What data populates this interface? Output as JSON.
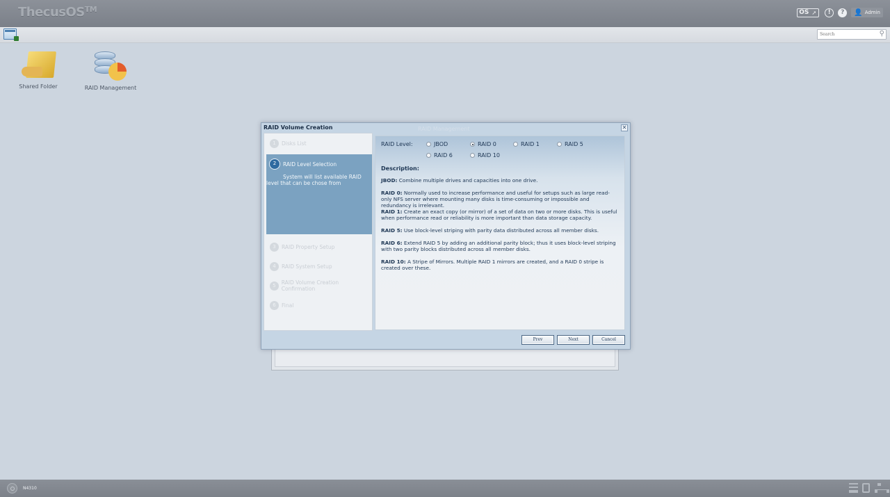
{
  "app": {
    "brand": "ThecusOS",
    "brand_tm": "TM",
    "os_badge": "OS",
    "admin_label": "Admin"
  },
  "search": {
    "placeholder": "Search"
  },
  "desktop": {
    "icons": [
      {
        "label": "Shared Folder",
        "icon": "shared-folder-icon"
      },
      {
        "label": "RAID Management",
        "icon": "raid-management-icon"
      }
    ]
  },
  "dialog": {
    "title": "RAID Volume Creation",
    "ghost_title": "RAID Management",
    "steps": [
      {
        "num": "1",
        "label": "Disks List"
      },
      {
        "num": "2",
        "label": "RAID Level Selection",
        "desc": "System will list available RAID level that can be chose from"
      },
      {
        "num": "3",
        "label": "RAID Property Setup"
      },
      {
        "num": "4",
        "label": "RAID System Setup"
      },
      {
        "num": "5",
        "label": "RAID Volume Creation Confirmation"
      },
      {
        "num": "6",
        "label": "Final"
      }
    ],
    "raid_level_label": "RAID Level:",
    "options": [
      {
        "label": "JBOD",
        "selected": false
      },
      {
        "label": "RAID 0",
        "selected": true
      },
      {
        "label": "RAID 1",
        "selected": false
      },
      {
        "label": "RAID 5",
        "selected": false
      },
      {
        "label": "RAID 6",
        "selected": false
      },
      {
        "label": "RAID 10",
        "selected": false
      }
    ],
    "description_title": "Description:",
    "descriptions": [
      {
        "term": "JBOD:",
        "text": " Combine multiple drives and capacities into one drive."
      },
      {
        "term": "RAID 0:",
        "text": " Normally used to increase performance and useful for setups such as large read-only NFS server where mounting many disks is time-consuming or impossible and redundancy is irrelevant."
      },
      {
        "term": "RAID 1:",
        "text": " Create an exact copy (or mirror) of a set of data on two or more disks. This is useful when performance read or reliability is more important than data storage capacity."
      },
      {
        "term": "RAID 5:",
        "text": " Use block-level striping with parity data distributed across all member disks."
      },
      {
        "term": "RAID 6:",
        "text": " Extend RAID 5 by adding an additional parity block; thus it uses block-level striping with two parity blocks distributed across all member disks."
      },
      {
        "term": "RAID 10:",
        "text": " A Stripe of Mirrors. Multiple RAID 1 mirrors are created, and a RAID 0 stripe is created over these."
      }
    ],
    "buttons": {
      "prev": "Prev",
      "next": "Next",
      "cancel": "Cancel"
    }
  },
  "taskbar": {
    "model": "N4310"
  }
}
